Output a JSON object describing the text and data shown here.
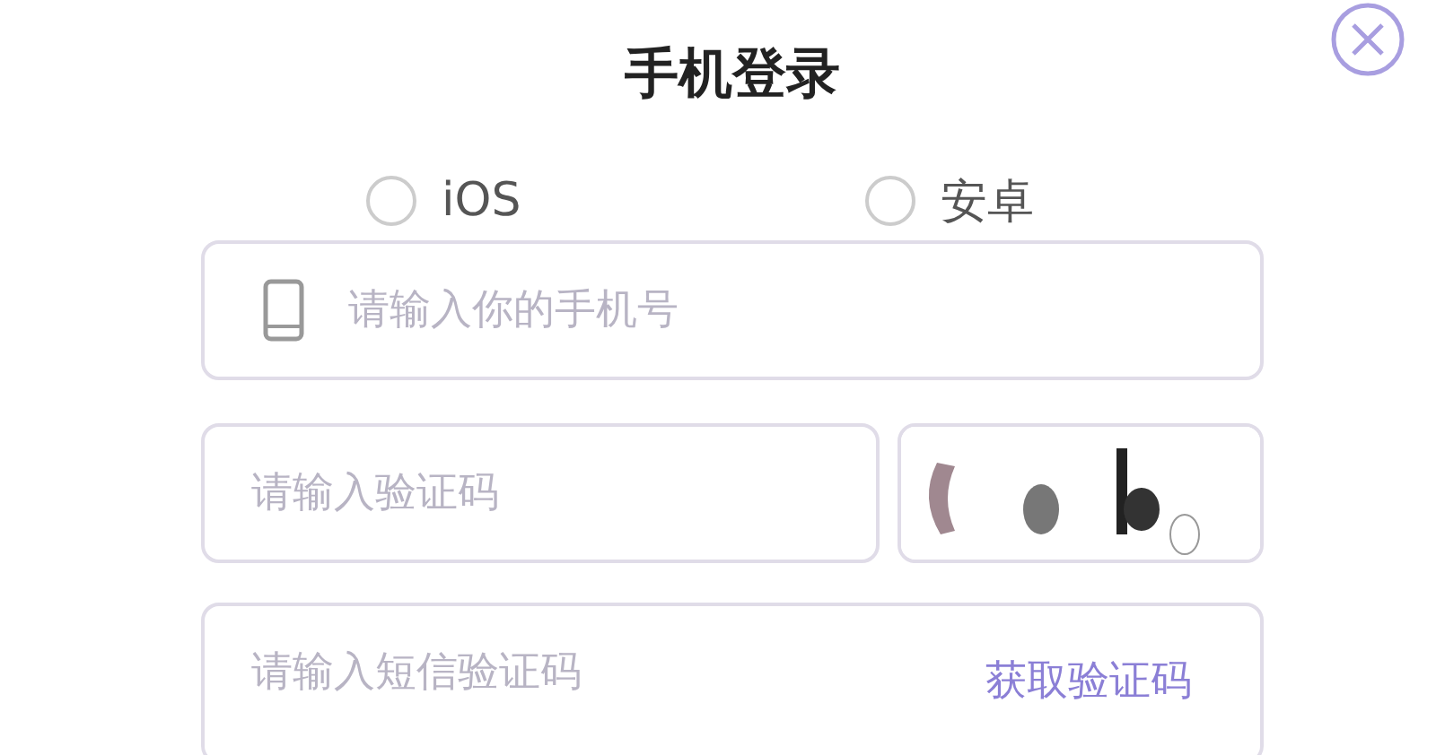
{
  "title": "手机登录",
  "platforms": [
    {
      "label": "iOS",
      "selected": false
    },
    {
      "label": "安卓",
      "selected": false
    }
  ],
  "phone_field": {
    "placeholder": "请输入你的手机号"
  },
  "captcha_field": {
    "placeholder": "请输入验证码"
  },
  "sms_field": {
    "placeholder": "请输入短信验证码",
    "action": "获取验证码"
  }
}
